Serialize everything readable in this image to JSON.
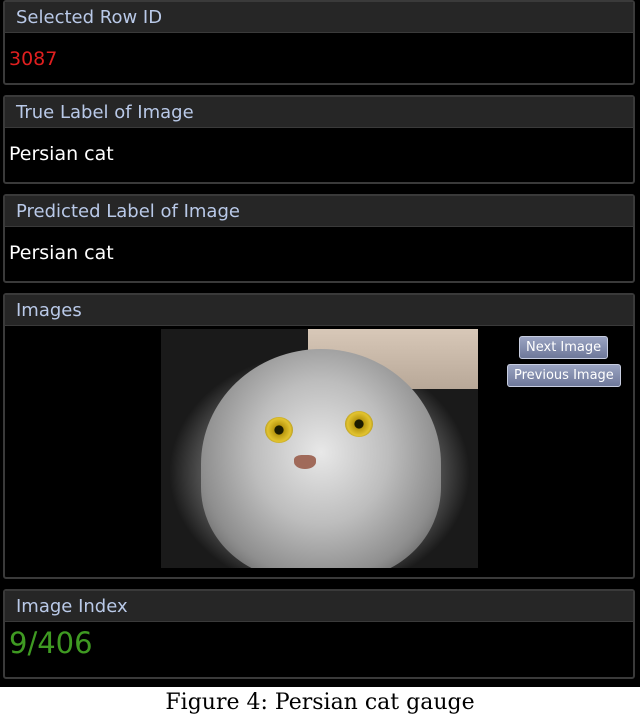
{
  "panels": {
    "row_id": {
      "title": "Selected Row ID",
      "value": "3087"
    },
    "true_label": {
      "title": "True Label of Image",
      "value": "Persian cat"
    },
    "predicted_label": {
      "title": "Predicted Label of Image",
      "value": "Persian cat"
    },
    "images": {
      "title": "Images",
      "next_button": "Next Image",
      "previous_button": "Previous Image"
    },
    "image_index": {
      "title": "Image Index",
      "value": "9/406"
    }
  },
  "caption": "Figure 4: Persian cat gauge",
  "colors": {
    "row_id_value": "#e01f1f",
    "image_index_value": "#3f9a22",
    "header_text": "#b9c9e8",
    "panel_background": "#262626"
  },
  "image_subject": "persian-cat-photo"
}
